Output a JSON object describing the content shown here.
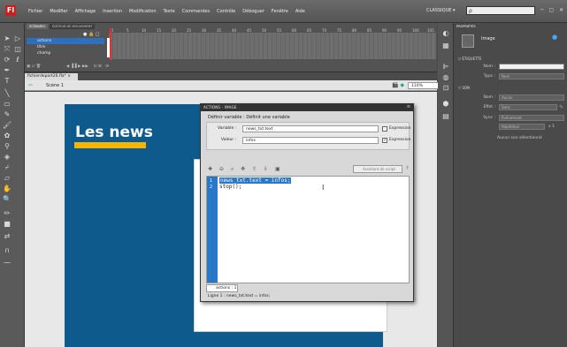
{
  "menubar": {
    "items": [
      "Fichier",
      "Modifier",
      "Affichage",
      "Insertion",
      "Modification",
      "Texte",
      "Commandes",
      "Contrôle",
      "Déboguer",
      "Fenêtre",
      "Aide"
    ],
    "workspace": "CLASSIQUE ▾",
    "search_placeholder": "ρ"
  },
  "timeline": {
    "tabs": [
      "SCÉNARIO",
      "ÉDITEUR DE MOUVEMENT"
    ],
    "layers": [
      {
        "name": "actions"
      },
      {
        "name": "titre"
      },
      {
        "name": "champ"
      }
    ],
    "ruler": [
      "1",
      "5",
      "10",
      "15",
      "20",
      "25",
      "30",
      "35",
      "40",
      "45",
      "50",
      "55",
      "60",
      "65",
      "70",
      "75",
      "80",
      "85",
      "90",
      "95",
      "100",
      "105"
    ]
  },
  "document": {
    "tab": "fichierdepart26.fla* ×",
    "scene": "Scène 1",
    "zoom": "110%"
  },
  "stage": {
    "title": "Les news"
  },
  "actions_panel": {
    "title": "ACTIONS - IMAGE",
    "description": "Définir variable : Définit une variable",
    "variable_label": "Variable :",
    "variable_value": "news_txt.text",
    "value_label": "Valeur :",
    "value_value": "infos",
    "expression_label": "Expression",
    "expression_label2": "Expression",
    "expr1_checked": "",
    "expr2_checked": "✓",
    "assist_label": "Assistant de script",
    "code_lines": [
      "news_txt.text = infos;",
      "stop();"
    ],
    "line_numbers": [
      "1",
      "2"
    ],
    "tab_label": "actions : 1",
    "status": "Ligne 1 : news_txt.text = infos;"
  },
  "properties": {
    "tab": "PROPRIÉTÉS",
    "type": "Image",
    "section_label": "ÉTIQUETTE",
    "name_label": "Nom :",
    "type_label": "Type :",
    "type_value": "Nom",
    "section_sound": "SON",
    "sound_name_label": "Nom :",
    "sound_name_value": "Aucun",
    "effect_label": "Effet :",
    "effect_value": "Sans",
    "sync_label": "Sync :",
    "sync_value": "Événement",
    "repeat_value": "Répétition",
    "repeat_count": "x 1",
    "no_sound": "Aucun son sélectionné"
  }
}
